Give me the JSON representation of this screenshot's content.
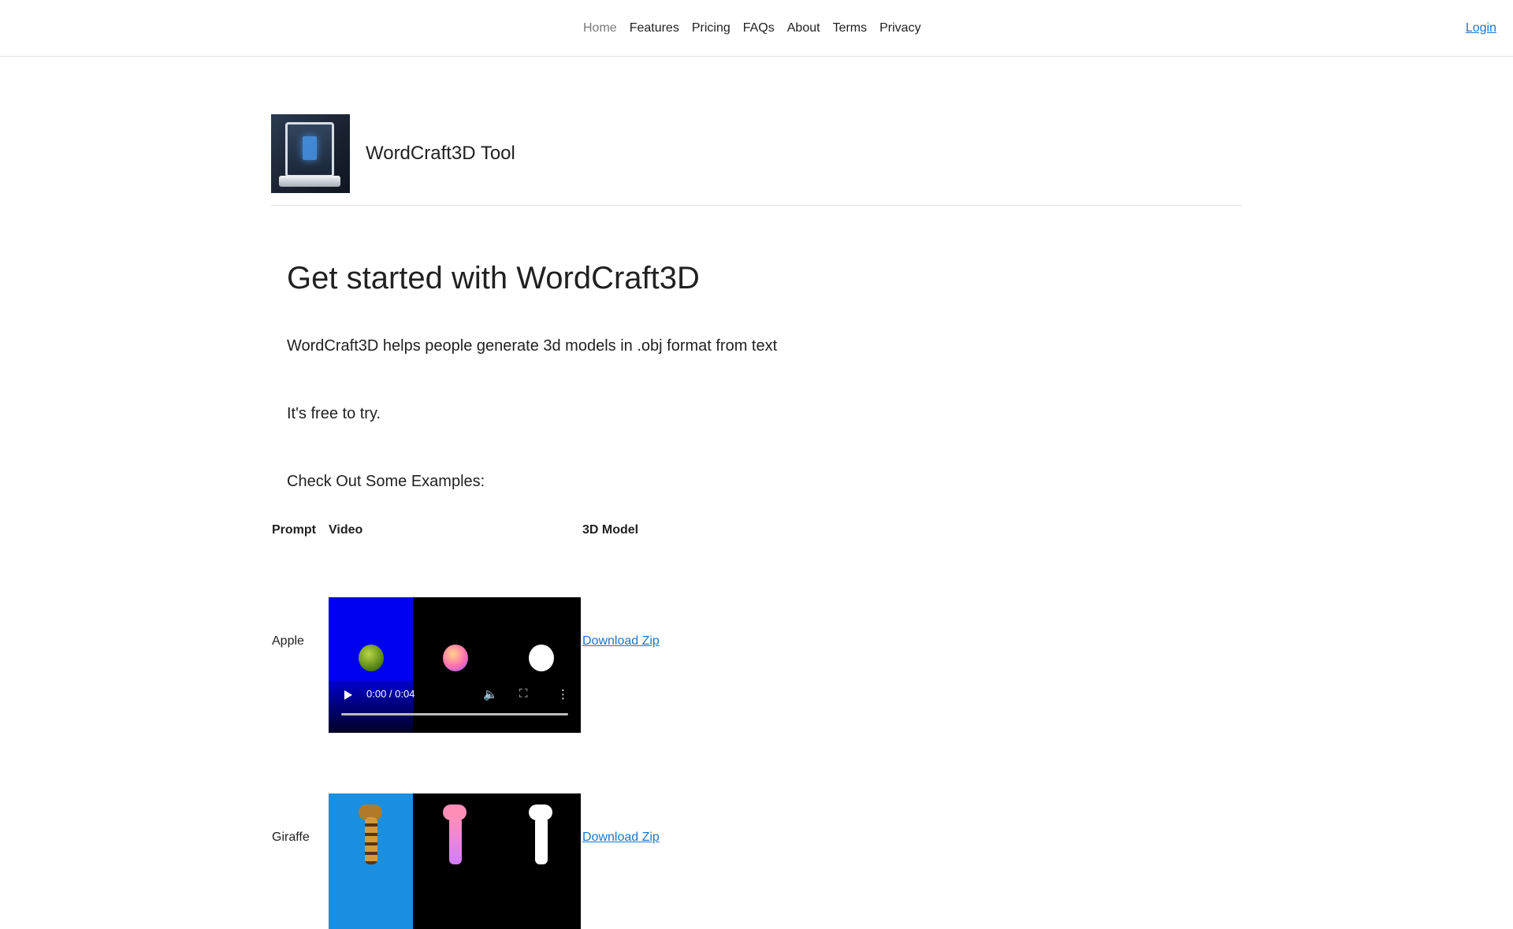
{
  "nav": {
    "items": [
      "Home",
      "Features",
      "Pricing",
      "FAQs",
      "About",
      "Terms",
      "Privacy"
    ],
    "active": "Home",
    "login": "Login"
  },
  "brand": {
    "name": "WordCraft3D Tool",
    "logo_icon": "3d-printer-icon"
  },
  "main": {
    "headline": "Get started with WordCraft3D",
    "description": "WordCraft3D helps people generate 3d models in .obj format from text",
    "free_text": "It's free to try.",
    "examples_title": "Check Out Some Examples:"
  },
  "table": {
    "headers": {
      "prompt": "Prompt",
      "video": "Video",
      "model": "3D Model"
    },
    "rows": [
      {
        "prompt": "Apple",
        "time": "0:00 / 0:04",
        "download": "Download Zip"
      },
      {
        "prompt": "Giraffe",
        "download": "Download Zip"
      }
    ]
  },
  "colors": {
    "link": "#1976d2",
    "apple_bg": "#0000f0",
    "giraffe_bg": "#1a8fe0"
  }
}
